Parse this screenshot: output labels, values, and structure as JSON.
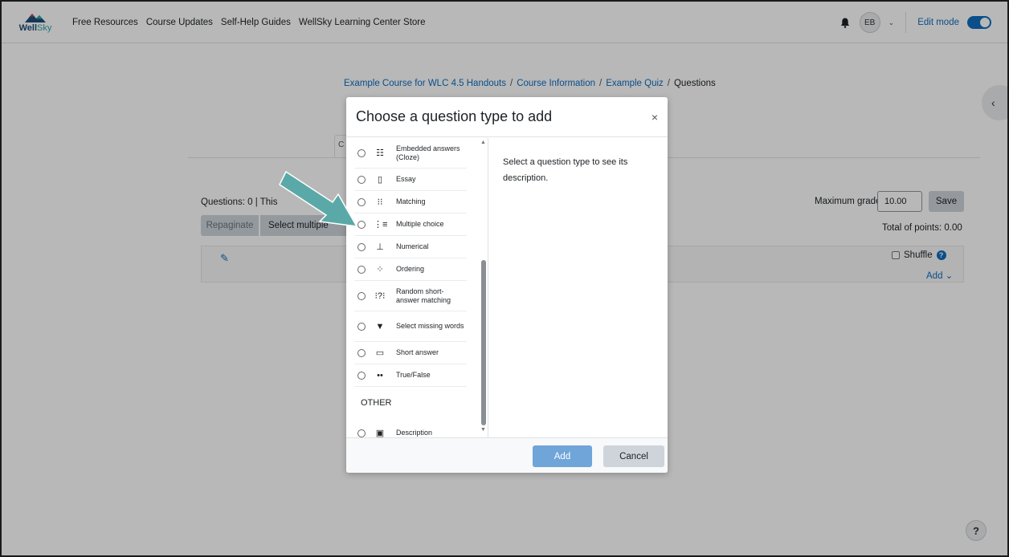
{
  "navbar": {
    "logo_text_a": "Well",
    "logo_text_b": "Sky",
    "links": [
      "Free Resources",
      "Course Updates",
      "Self-Help Guides",
      "WellSky Learning Center Store"
    ],
    "avatar_initials": "EB",
    "edit_mode_label": "Edit mode",
    "edit_mode_on": true
  },
  "breadcrumb": {
    "items": [
      "Example Course for WLC 4.5 Handouts",
      "Course Information",
      "Example Quiz",
      "Questions"
    ],
    "separator": "/"
  },
  "page": {
    "tab_stub": "C",
    "questions_info": "Questions: 0 | This",
    "repaginate_label": "Repaginate",
    "select_multiple_label": "Select multiple",
    "max_grade_label": "Maximum grade",
    "max_grade_value": "10.00",
    "save_label": "Save",
    "total_points": "Total of points: 0.00",
    "shuffle_label": "Shuffle",
    "help_glyph": "?",
    "add_label": "Add ⌄"
  },
  "modal": {
    "title": "Choose a question type to add",
    "close_glyph": "×",
    "question_types": [
      {
        "label": "Embedded answers (Cloze)",
        "icon": "cloze-icon",
        "glyph": "☷"
      },
      {
        "label": "Essay",
        "icon": "essay-icon",
        "glyph": "▯"
      },
      {
        "label": "Matching",
        "icon": "matching-icon",
        "glyph": "⁝⁝"
      },
      {
        "label": "Multiple choice",
        "icon": "multiple-choice-icon",
        "glyph": "⋮≡"
      },
      {
        "label": "Numerical",
        "icon": "numerical-icon",
        "glyph": "⊥"
      },
      {
        "label": "Ordering",
        "icon": "ordering-icon",
        "glyph": "⁘"
      },
      {
        "label": "Random short-answer matching",
        "icon": "random-short-answer-icon",
        "glyph": "⁝?⁝"
      },
      {
        "label": "Select missing words",
        "icon": "select-missing-words-icon",
        "glyph": "▼"
      },
      {
        "label": "Short answer",
        "icon": "short-answer-icon",
        "glyph": "▭"
      },
      {
        "label": "True/False",
        "icon": "true-false-icon",
        "glyph": "••"
      }
    ],
    "other_heading": "OTHER",
    "other_types": [
      {
        "label": "Description",
        "icon": "description-icon",
        "glyph": "▣"
      }
    ],
    "description_text": "Select a question type to see its description.",
    "add_label": "Add",
    "cancel_label": "Cancel"
  },
  "colors": {
    "accent": "#0f6cbf",
    "annotation_arrow": "#5aa9a8"
  }
}
